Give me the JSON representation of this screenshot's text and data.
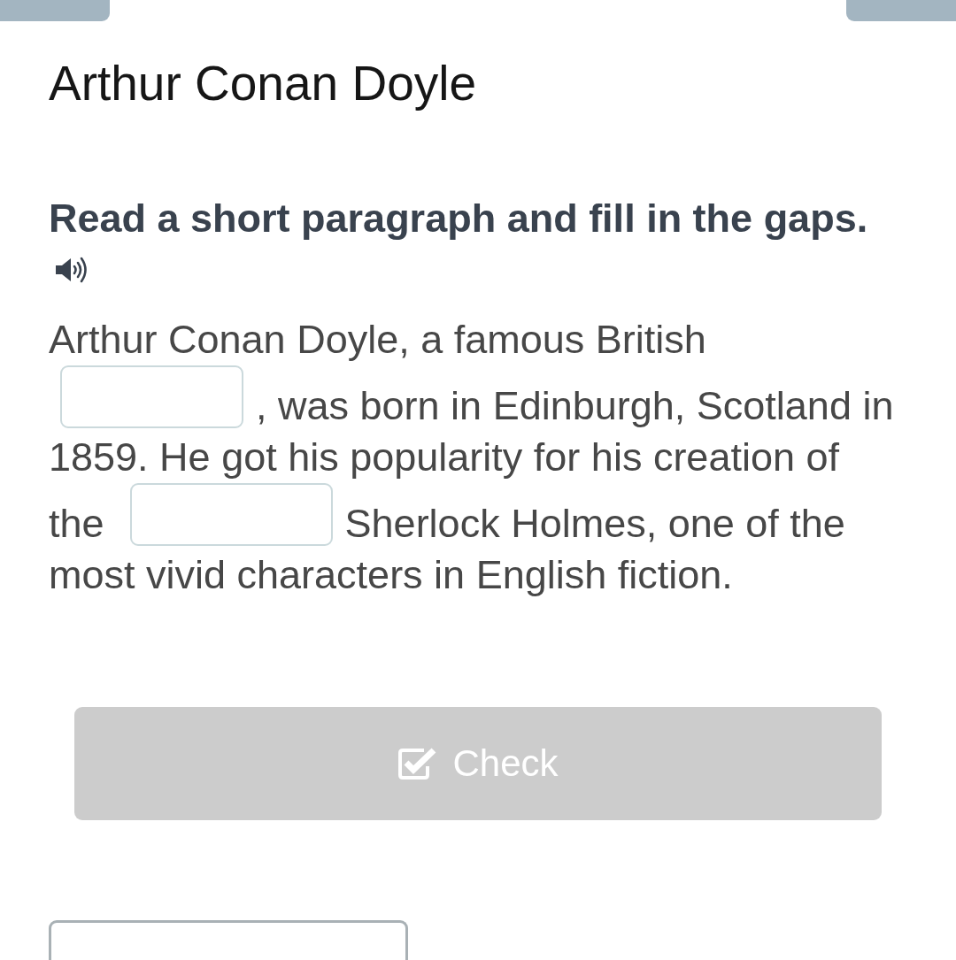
{
  "title": "Arthur Conan Doyle",
  "instruction": "Read a short paragraph and fill in the gaps.",
  "passage": {
    "lines": [
      [
        {
          "kind": "text",
          "text": "Arthur Conan Doyle, a famous British"
        }
      ],
      [
        {
          "kind": "gap"
        },
        {
          "kind": "text",
          "text": ", was born in Edinburgh, Scotland in"
        }
      ],
      [
        {
          "kind": "text",
          "text": "1859. He got his popularity for his creation of"
        }
      ],
      [
        {
          "kind": "text",
          "text": "the"
        },
        {
          "kind": "gap"
        },
        {
          "kind": "text",
          "text": "Sherlock Holmes, one of the"
        }
      ],
      [
        {
          "kind": "text",
          "text": "most vivid characters in English fiction."
        }
      ]
    ]
  },
  "check_button": {
    "label": "Check",
    "disabled": true
  }
}
